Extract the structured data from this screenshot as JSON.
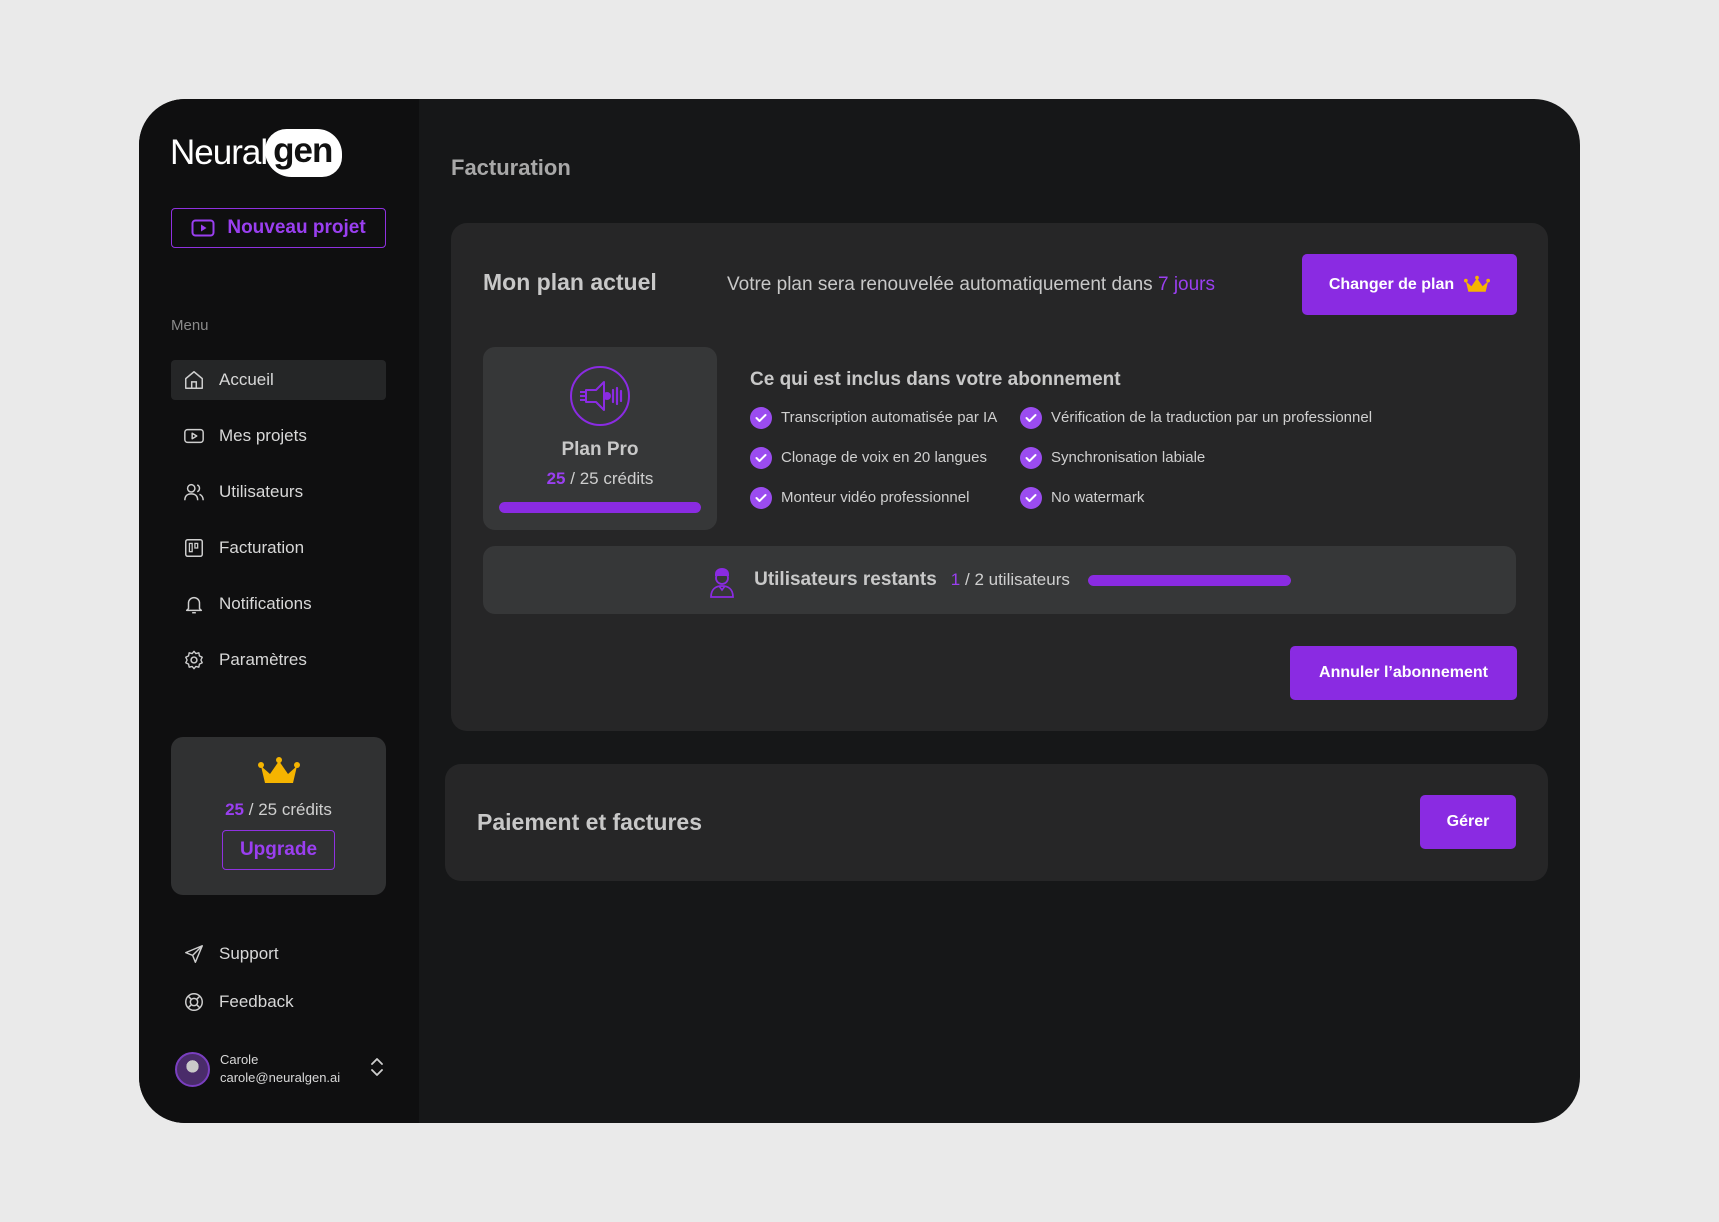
{
  "brand": {
    "logo_prefix": "Neural",
    "logo_suffix": "gen"
  },
  "sidebar": {
    "new_project_label": "Nouveau projet",
    "menu_label": "Menu",
    "items": [
      {
        "label": "Accueil",
        "icon": "home-icon"
      },
      {
        "label": "Mes projets",
        "icon": "video-icon"
      },
      {
        "label": "Utilisateurs",
        "icon": "users-icon"
      },
      {
        "label": "Facturation",
        "icon": "billing-icon"
      },
      {
        "label": "Notifications",
        "icon": "bell-icon"
      },
      {
        "label": "Paramètres",
        "icon": "gear-icon"
      }
    ],
    "credits": {
      "used": "25",
      "rest": "/ 25 crédits",
      "upgrade_label": "Upgrade"
    },
    "support_label": "Support",
    "feedback_label": "Feedback",
    "user": {
      "name": "Carole",
      "email": "carole@neuralgen.ai"
    }
  },
  "main": {
    "page_title": "Facturation",
    "plan": {
      "heading": "Mon plan actuel",
      "renew_prefix": "Votre plan sera renouvelée automatiquement dans",
      "renew_days": "7 jours",
      "change_plan_label": "Changer de plan",
      "plan_name": "Plan Pro",
      "credits_used": "25",
      "credits_rest": "/ 25 crédits",
      "credits_fraction": 1.0,
      "features_title": "Ce qui est inclus dans votre abonnement",
      "features": [
        "Transcription automatisée par IA",
        "Vérification de la traduction par un professionnel",
        "Clonage de voix en 20 langues",
        "Synchronisation labiale",
        "Monteur vidéo professionnel",
        "No watermark"
      ],
      "users_label": "Utilisateurs restants",
      "users_used": "1",
      "users_rest": "/ 2 utilisateurs",
      "users_fraction": 1.0,
      "cancel_label": "Annuler l’abonnement"
    },
    "payment": {
      "title": "Paiement et factures",
      "manage_label": "Gérer"
    }
  },
  "colors": {
    "accent": "#8a2be2",
    "crown": "#f5b400",
    "background": "#161718",
    "card": "#262627"
  }
}
